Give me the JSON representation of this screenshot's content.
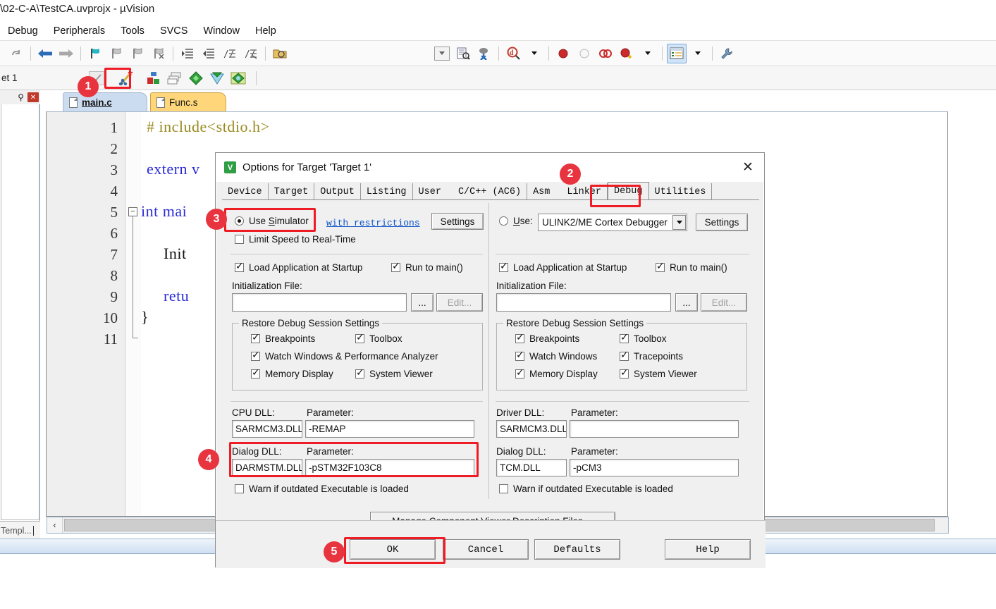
{
  "window": {
    "title": "\\02-C-A\\TestCA.uvprojx - µVision",
    "menu": [
      "Debug",
      "Peripherals",
      "Tools",
      "SVCS",
      "Window",
      "Help"
    ]
  },
  "toolbar1": {
    "icons": [
      "redo-icon",
      "back-arrow-icon",
      "forward-arrow-icon",
      "bookmark-icon",
      "bookmark-prev-icon",
      "bookmark-next-icon",
      "bookmark-clear-icon",
      "indent-icon",
      "outdent-icon",
      "comment-icon",
      "uncomment-icon",
      "open-folder-icon",
      "dropdown-icon",
      "target-options-icon",
      "batch-build-icon",
      "magnifier-icon",
      "insert-breakpoint-icon",
      "disable-breakpoint-icon",
      "kill-all-breakpoints-icon",
      "disable-all-breakpoints-icon",
      "manage-windows-icon",
      "configure-icon"
    ]
  },
  "toolbar2": {
    "target_selector_value": "et 1",
    "icons": [
      "checkmark-icon",
      "target-options-magicwand-icon",
      "build-icon",
      "batch-build-icon",
      "manage-rte-icon",
      "pack-installer-icon",
      "manage-project-icon"
    ]
  },
  "left_panel": {
    "pin_icon": "pin-icon",
    "close_icon": "close-icon",
    "bottom_tab": "Templ..."
  },
  "editor": {
    "tabs": [
      {
        "label": "main.c",
        "active": true
      },
      {
        "label": "Func.s",
        "active": false
      }
    ],
    "line_numbers": [
      "1",
      "2",
      "3",
      "4",
      "5",
      "6",
      "7",
      "8",
      "9",
      "10",
      "11"
    ],
    "code_lines": [
      {
        "n": 1,
        "segments": [
          {
            "t": "# include<stdio.h>",
            "c": "pp"
          }
        ]
      },
      {
        "n": 2,
        "segments": []
      },
      {
        "n": 3,
        "segments": [
          {
            "t": "extern v",
            "c": "kw"
          }
        ]
      },
      {
        "n": 4,
        "segments": []
      },
      {
        "n": 5,
        "segments": [
          {
            "t": "int mai",
            "c": "kw"
          }
        ]
      },
      {
        "n": 6,
        "segments": []
      },
      {
        "n": 7,
        "segments": [
          {
            "t": "    Init",
            "c": "pln"
          }
        ]
      },
      {
        "n": 8,
        "segments": []
      },
      {
        "n": 9,
        "segments": [
          {
            "t": "    retu",
            "c": "kw"
          }
        ]
      },
      {
        "n": 10,
        "segments": [
          {
            "t": "}",
            "c": "pln"
          }
        ]
      },
      {
        "n": 11,
        "segments": []
      }
    ],
    "hscroll_left_arrow": "‹"
  },
  "dialog": {
    "title": "Options for Target 'Target 1'",
    "icon": "uvision-logo-icon",
    "close_icon": "close-icon",
    "tabs": [
      {
        "label": "Device",
        "selected": false
      },
      {
        "label": "Target",
        "selected": false
      },
      {
        "label": "Output",
        "selected": false
      },
      {
        "label": "Listing",
        "selected": false
      },
      {
        "label": "User",
        "selected": false
      },
      {
        "label": "C/C++ (AC6)",
        "selected": false
      },
      {
        "label": "Asm",
        "selected": false
      },
      {
        "label": "Linker",
        "selected": false
      },
      {
        "label": "Debug",
        "selected": true
      },
      {
        "label": "Utilities",
        "selected": false
      }
    ],
    "left": {
      "use_simulator_label": "Use Simulator",
      "use_simulator_checked": true,
      "with_restrictions_link": "with restrictions",
      "settings_button": "Settings",
      "limit_speed_label": "Limit Speed to Real-Time",
      "limit_speed_checked": false,
      "load_app_label": "Load Application at Startup",
      "load_app_checked": true,
      "run_to_main_label": "Run to main()",
      "run_to_main_checked": true,
      "init_file_label": "Initialization File:",
      "init_file_value": "",
      "browse_button": "...",
      "edit_button": "Edit...",
      "restore_group_title": "Restore Debug Session Settings",
      "restore_items": [
        {
          "label": "Breakpoints",
          "checked": true
        },
        {
          "label": "Toolbox",
          "checked": true
        },
        {
          "label": "Watch Windows & Performance Analyzer",
          "checked": true
        },
        {
          "label": "Memory Display",
          "checked": true
        },
        {
          "label": "System Viewer",
          "checked": true
        }
      ],
      "cpu_dll_label": "CPU DLL:",
      "cpu_dll_value": "SARMCM3.DLL",
      "cpu_param_label": "Parameter:",
      "cpu_param_value": "-REMAP",
      "dialog_dll_label": "Dialog DLL:",
      "dialog_dll_value": "DARMSTM.DLL",
      "dialog_param_label": "Parameter:",
      "dialog_param_value": "-pSTM32F103C8",
      "warn_outdated_label": "Warn if outdated Executable is loaded",
      "warn_outdated_checked": false
    },
    "right": {
      "use_label": "Use:",
      "use_checked": false,
      "use_value": "ULINK2/ME Cortex Debugger",
      "settings_button": "Settings",
      "load_app_label": "Load Application at Startup",
      "load_app_checked": true,
      "run_to_main_label": "Run to main()",
      "run_to_main_checked": true,
      "init_file_label": "Initialization File:",
      "init_file_value": "",
      "browse_button": "...",
      "edit_button": "Edit...",
      "restore_group_title": "Restore Debug Session Settings",
      "restore_items": [
        {
          "label": "Breakpoints",
          "checked": true
        },
        {
          "label": "Toolbox",
          "checked": true
        },
        {
          "label": "Watch Windows",
          "checked": true
        },
        {
          "label": "Tracepoints",
          "checked": true
        },
        {
          "label": "Memory Display",
          "checked": true
        },
        {
          "label": "System Viewer",
          "checked": true
        }
      ],
      "driver_dll_label": "Driver DLL:",
      "driver_dll_value": "SARMCM3.DLL",
      "driver_param_label": "Parameter:",
      "driver_param_value": "",
      "dialog_dll_label": "Dialog DLL:",
      "dialog_dll_value": "TCM.DLL",
      "dialog_param_label": "Parameter:",
      "dialog_param_value": "-pCM3",
      "warn_outdated_label": "Warn if outdated Executable is loaded",
      "warn_outdated_checked": false
    },
    "manage_button": "Manage Component Viewer Description Files ...",
    "footer": {
      "ok": "OK",
      "cancel": "Cancel",
      "defaults": "Defaults",
      "help": "Help"
    }
  },
  "annotations": {
    "accent_color": "#ee1c24",
    "badge_color": "#e8343f",
    "steps": [
      {
        "n": "1",
        "target": "toolbar-target-options-icon"
      },
      {
        "n": "2",
        "target": "dialog-tab-debug"
      },
      {
        "n": "3",
        "target": "use-simulator-radio"
      },
      {
        "n": "4",
        "target": "dialog-dll-fields"
      },
      {
        "n": "5",
        "target": "ok-button"
      }
    ]
  }
}
